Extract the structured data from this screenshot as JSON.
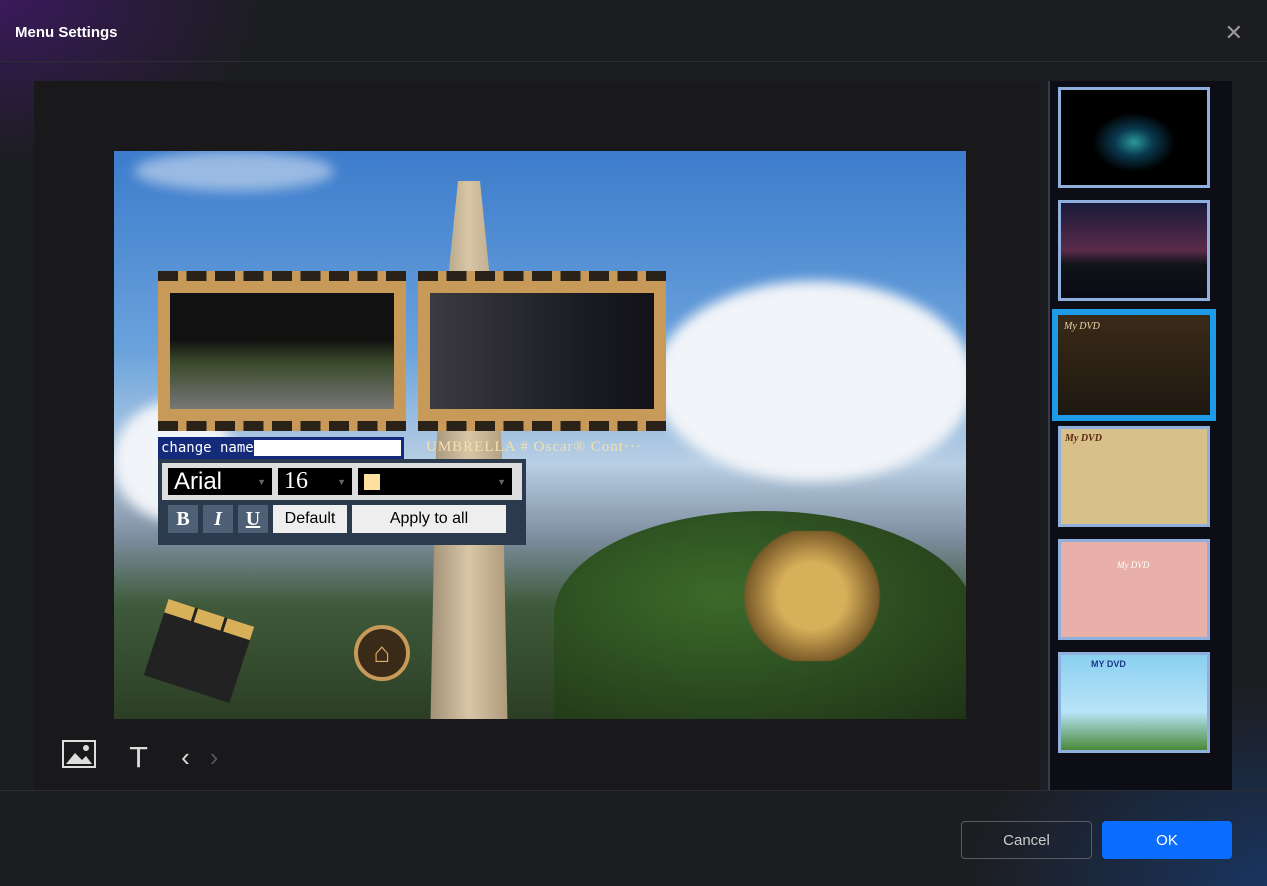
{
  "dialog": {
    "title": "Menu Settings"
  },
  "preview": {
    "chapters": [
      {
        "title": "change name",
        "selected": true
      },
      {
        "title": "UMBRELLA # Oscar® Cont···"
      }
    ],
    "text_toolbar": {
      "font": "Arial",
      "size": "16",
      "color": "#fddf9e",
      "bold": "B",
      "italic": "I",
      "underline": "U",
      "default_label": "Default",
      "apply_all_label": "Apply to all"
    }
  },
  "bottom_tools": [
    "image-icon",
    "text-icon",
    "prev-icon",
    "next-icon"
  ],
  "templates": [
    {
      "selected": false
    },
    {
      "selected": false
    },
    {
      "selected": true,
      "caption": "My DVD"
    },
    {
      "selected": false,
      "caption": "My DVD"
    },
    {
      "selected": false,
      "caption": "My DVD"
    },
    {
      "selected": false,
      "caption": "MY DVD"
    }
  ],
  "footer": {
    "cancel_label": "Cancel",
    "ok_label": "OK"
  },
  "colors": {
    "accent": "#0a6dff",
    "selected_border": "#1e9be6"
  }
}
